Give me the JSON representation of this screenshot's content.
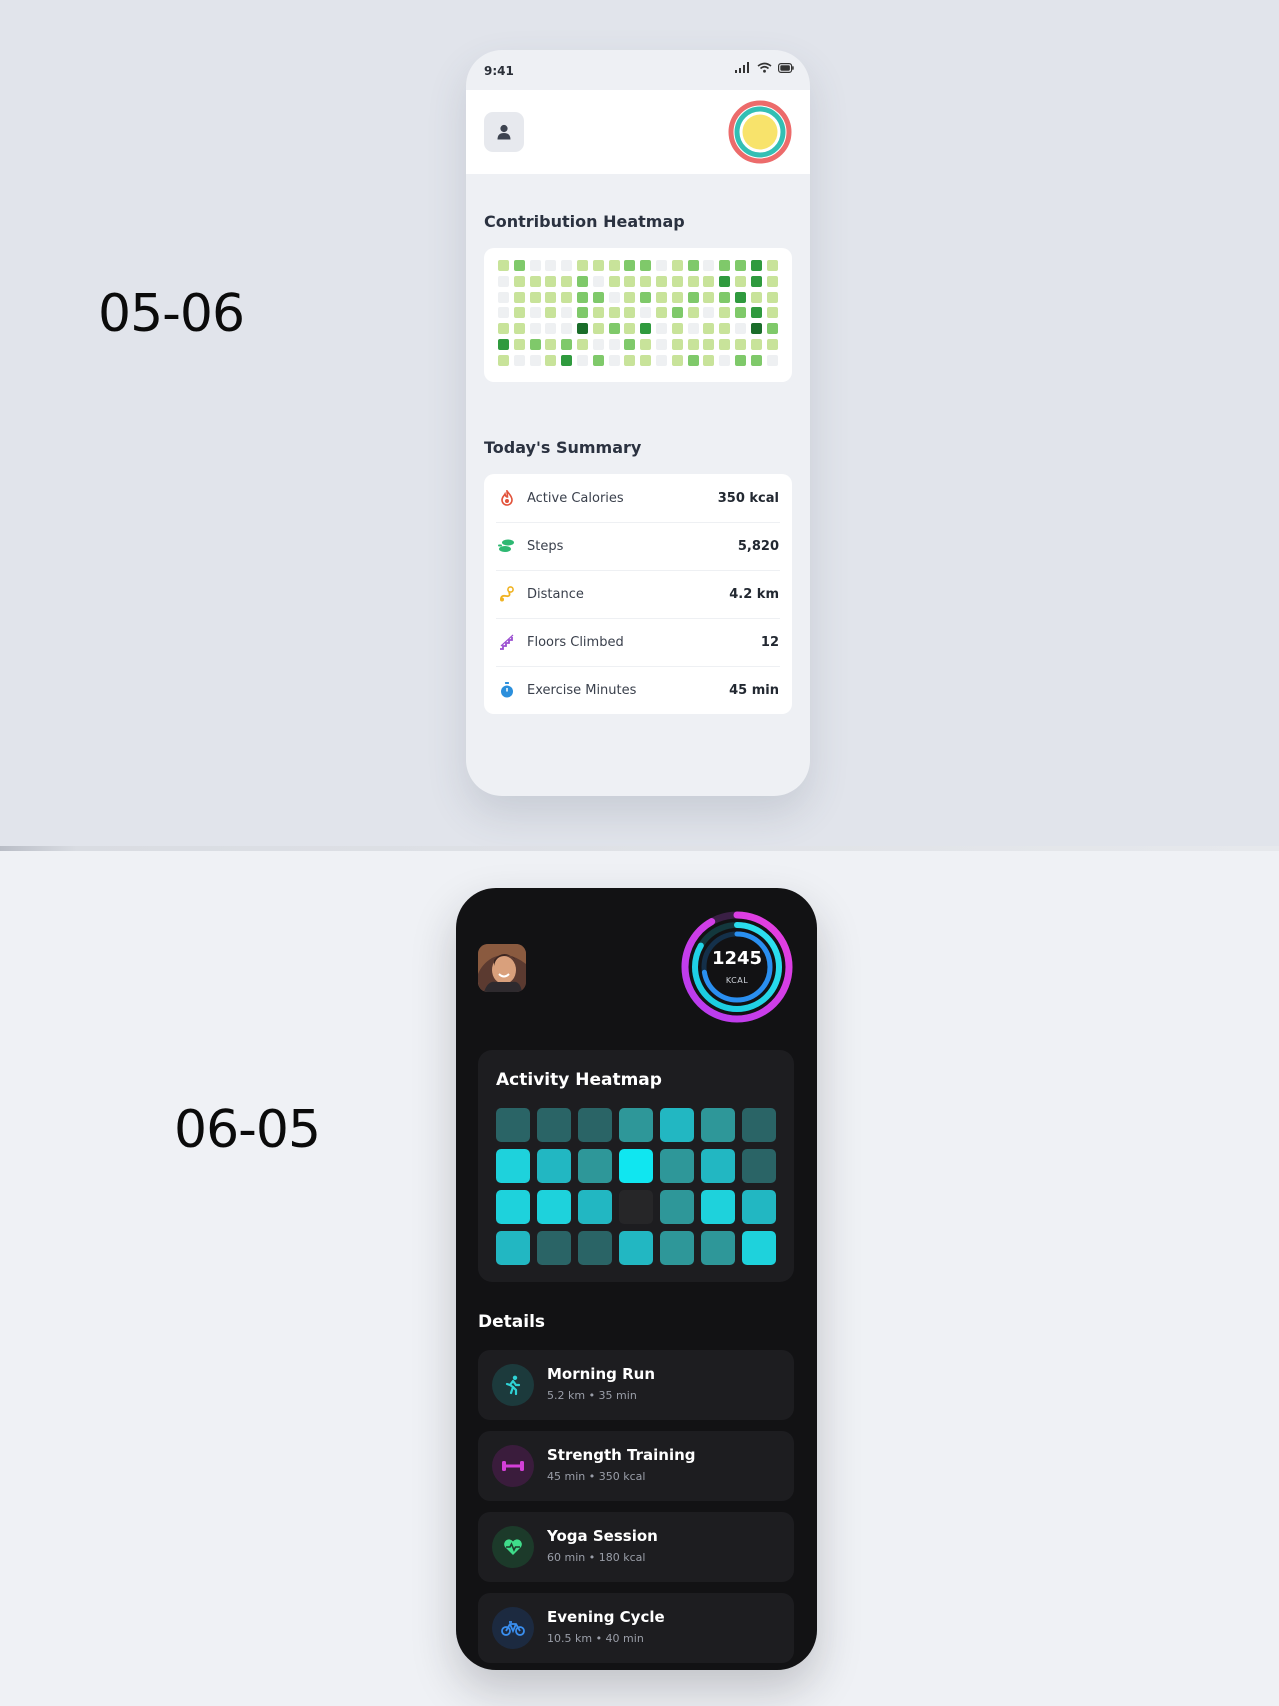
{
  "labels": {
    "top": "05-06",
    "bottom": "06-05"
  },
  "light": {
    "status_time": "9:41",
    "heatmap_title": "Contribution Heatmap",
    "heatmap_levels": [
      [
        1,
        2,
        0,
        0,
        0,
        1,
        1,
        1,
        2,
        2,
        0,
        1,
        2,
        0,
        2,
        2,
        3,
        1
      ],
      [
        0,
        1,
        1,
        1,
        1,
        2,
        0,
        1,
        1,
        1,
        1,
        1,
        1,
        1,
        3,
        1,
        3,
        1
      ],
      [
        0,
        1,
        1,
        1,
        1,
        2,
        2,
        0,
        1,
        2,
        1,
        1,
        2,
        1,
        2,
        3,
        1,
        1
      ],
      [
        0,
        1,
        0,
        1,
        0,
        2,
        1,
        1,
        1,
        0,
        1,
        2,
        1,
        0,
        1,
        2,
        3,
        1
      ],
      [
        1,
        1,
        0,
        0,
        0,
        4,
        1,
        2,
        1,
        3,
        0,
        1,
        0,
        1,
        1,
        0,
        4,
        2
      ],
      [
        3,
        1,
        2,
        1,
        2,
        1,
        0,
        0,
        2,
        1,
        0,
        1,
        1,
        1,
        1,
        1,
        1,
        1
      ],
      [
        1,
        0,
        0,
        1,
        3,
        0,
        2,
        0,
        1,
        1,
        0,
        1,
        2,
        1,
        0,
        2,
        2,
        0
      ]
    ],
    "summary_title": "Today's Summary",
    "summary": [
      {
        "label": "Active Calories",
        "value": "350 kcal",
        "icon": "flame-icon",
        "color": "#e2533b"
      },
      {
        "label": "Steps",
        "value": "5,820",
        "icon": "footsteps-icon",
        "color": "#2eb872"
      },
      {
        "label": "Distance",
        "value": "4.2 km",
        "icon": "route-icon",
        "color": "#f0b323"
      },
      {
        "label": "Floors Climbed",
        "value": "12",
        "icon": "stairs-icon",
        "color": "#9b4fd1"
      },
      {
        "label": "Exercise Minutes",
        "value": "45 min",
        "icon": "stopwatch-icon",
        "color": "#2b8fdc"
      }
    ]
  },
  "dark": {
    "ring_value": "1245",
    "ring_unit": "KCAL",
    "heatmap_title": "Activity Heatmap",
    "heatmap_levels": [
      [
        1,
        1,
        1,
        2,
        3,
        2,
        1
      ],
      [
        4,
        3,
        2,
        5,
        2,
        3,
        1
      ],
      [
        4,
        4,
        3,
        0,
        2,
        4,
        3
      ],
      [
        3,
        1,
        1,
        3,
        2,
        2,
        4
      ]
    ],
    "details_title": "Details",
    "activities": [
      {
        "name": "Morning Run",
        "meta": "5.2 km • 35 min",
        "icon": "running-icon",
        "color": "#2fd3d6"
      },
      {
        "name": "Strength Training",
        "meta": "45 min • 350 kcal",
        "icon": "dumbbell-icon",
        "color": "#d43fd8"
      },
      {
        "name": "Yoga Session",
        "meta": "60 min • 180 kcal",
        "icon": "heart-pulse-icon",
        "color": "#3fdc8a"
      },
      {
        "name": "Evening Cycle",
        "meta": "10.5 km • 40 min",
        "icon": "bicycle-icon",
        "color": "#3a8ff0"
      }
    ]
  }
}
